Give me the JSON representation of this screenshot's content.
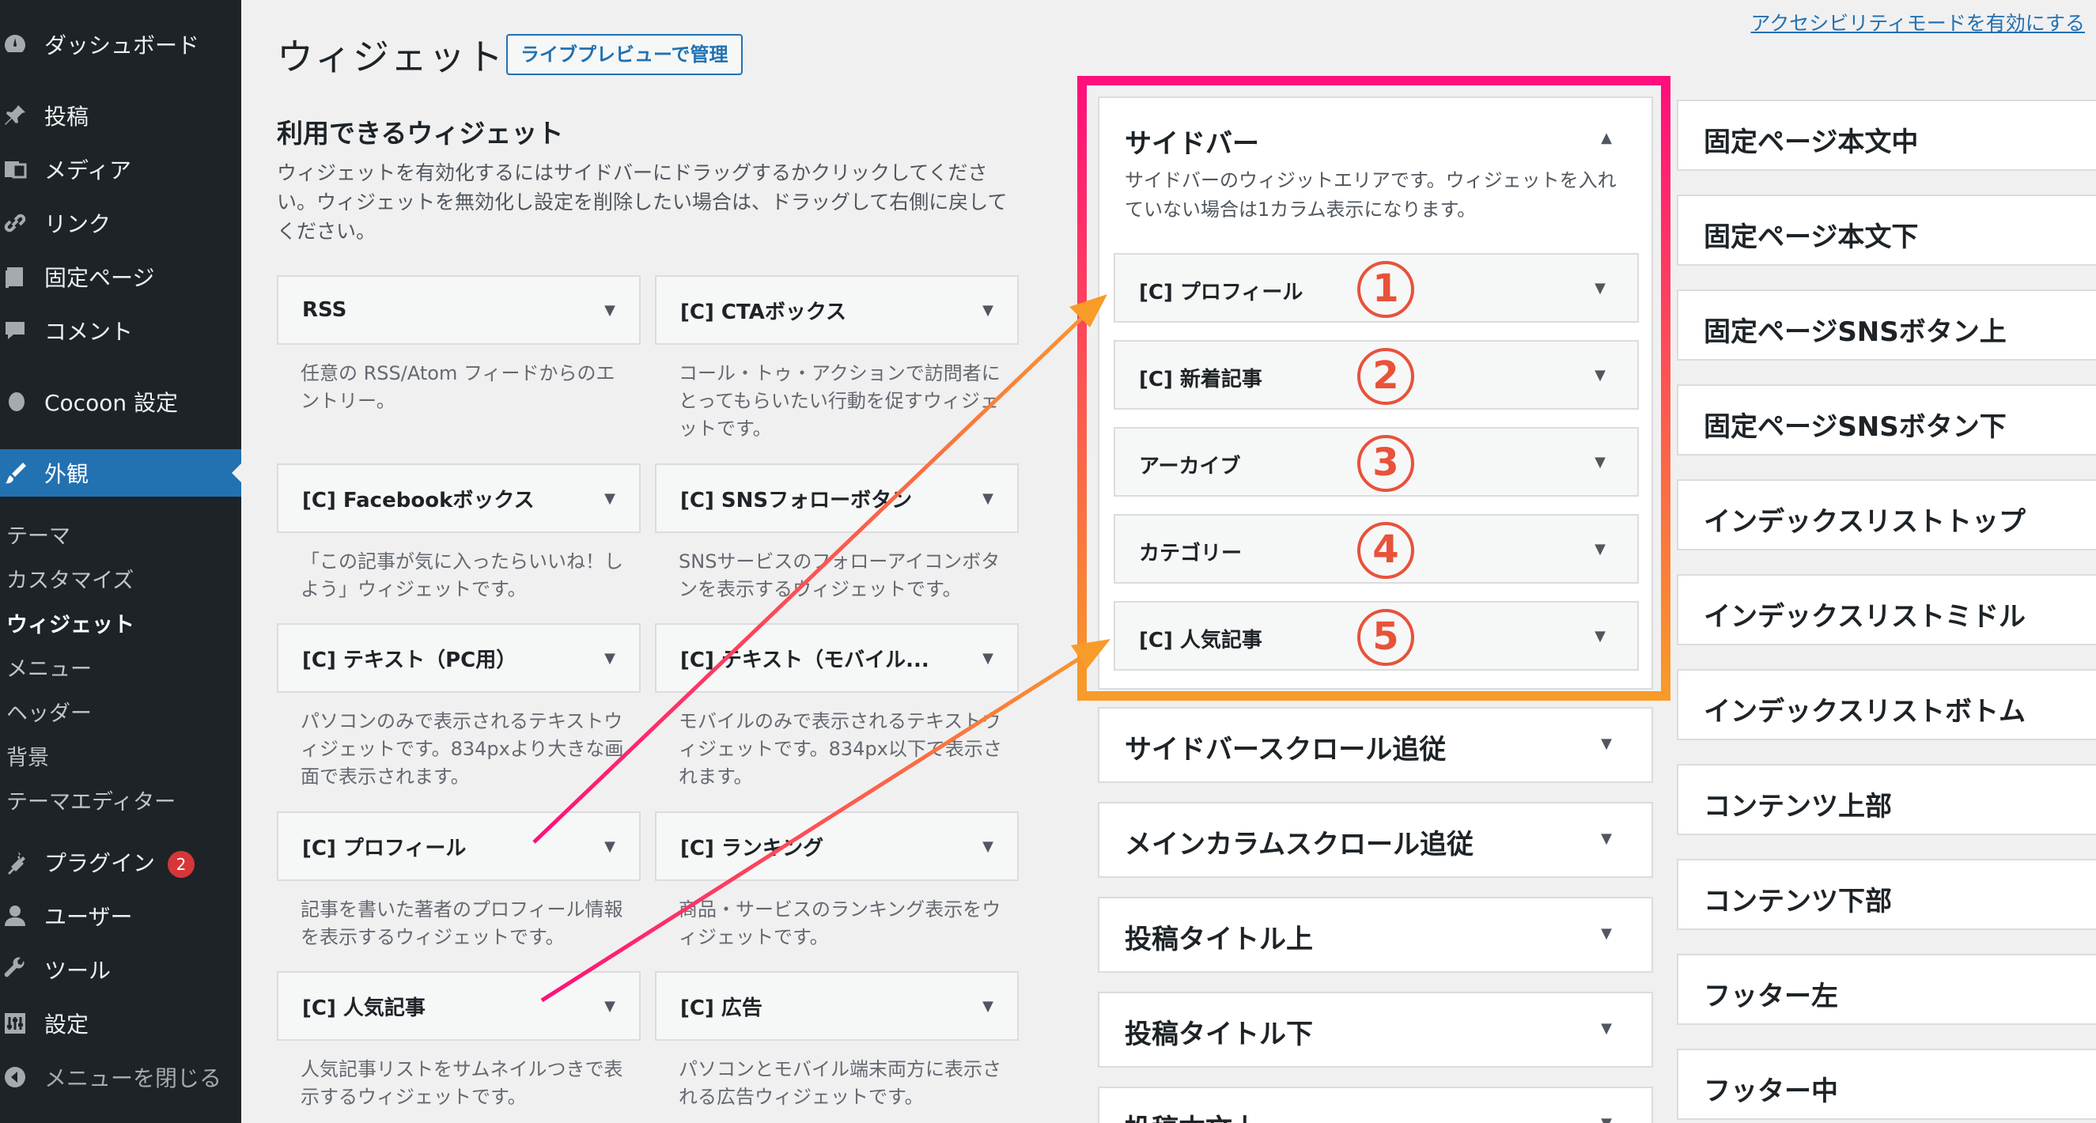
{
  "sidebar": {
    "items": [
      {
        "label": "ダッシュボード",
        "icon": "dashboard-icon"
      },
      {
        "label": "投稿",
        "icon": "pin-icon"
      },
      {
        "label": "メディア",
        "icon": "media-icon"
      },
      {
        "label": "リンク",
        "icon": "link-icon"
      },
      {
        "label": "固定ページ",
        "icon": "page-icon"
      },
      {
        "label": "コメント",
        "icon": "comment-icon"
      },
      {
        "label": "Cocoon 設定",
        "icon": "cocoon-icon"
      },
      {
        "label": "外観",
        "icon": "brush-icon"
      }
    ],
    "submenu": [
      "テーマ",
      "カスタマイズ",
      "ウィジェット",
      "メニュー",
      "ヘッダー",
      "背景",
      "テーマエディター"
    ],
    "items_after": [
      {
        "label": "プラグイン",
        "icon": "plugin-icon",
        "badge": "2"
      },
      {
        "label": "ユーザー",
        "icon": "user-icon"
      },
      {
        "label": "ツール",
        "icon": "wrench-icon"
      },
      {
        "label": "設定",
        "icon": "settings-icon"
      },
      {
        "label": "メニューを閉じる",
        "icon": "collapse-icon"
      }
    ]
  },
  "header": {
    "title": "ウィジェット",
    "live_preview": "ライブプレビューで管理",
    "accessibility_link": "アクセシビリティモードを有効にする"
  },
  "available": {
    "heading": "利用できるウィジェット",
    "description": "ウィジェットを有効化するにはサイドバーにドラッグするかクリックしてください。ウィジェットを無効化し設定を削除したい場合は、ドラッグして右側に戻してください。",
    "widgets": [
      {
        "title": "RSS",
        "desc": "任意の RSS/Atom フィードからのエントリー。"
      },
      {
        "title": "[C] CTAボックス",
        "desc": "コール・トゥ・アクションで訪問者にとってもらいたい行動を促すウィジェットです。"
      },
      {
        "title": "[C] Facebookボックス",
        "desc": "「この記事が気に入ったらいいね！しよう」ウィジェットです。"
      },
      {
        "title": "[C] SNSフォローボタン",
        "desc": "SNSサービスのフォローアイコンボタンを表示するウィジェットです。"
      },
      {
        "title": "[C] テキスト（PC用）",
        "desc": "パソコンのみで表示されるテキストウィジェットです。834pxより大きな画面で表示されます。"
      },
      {
        "title": "[C] テキスト（モバイル...",
        "desc": "モバイルのみで表示されるテキストウィジェットです。834px以下で表示されます。"
      },
      {
        "title": "[C] プロフィール",
        "desc": "記事を書いた著者のプロフィール情報を表示するウィジェットです。"
      },
      {
        "title": "[C] ランキング",
        "desc": "商品・サービスのランキング表示をウィジェットです。"
      },
      {
        "title": "[C] 人気記事",
        "desc": "人気記事リストをサムネイルつきで表示するウィジェットです。"
      },
      {
        "title": "[C] 広告",
        "desc": "パソコンとモバイル端末両方に表示される広告ウィジェットです。"
      }
    ]
  },
  "sidebar_area": {
    "title": "サイドバー",
    "description": "サイドバーのウィジットエリアです。ウィジェットを入れていない場合は1カラム表示になります。",
    "widgets": [
      {
        "title": "[C] プロフィール",
        "num": "1"
      },
      {
        "title": "[C] 新着記事",
        "num": "2"
      },
      {
        "title": "アーカイブ",
        "num": "3"
      },
      {
        "title": "カテゴリー",
        "num": "4"
      },
      {
        "title": "[C] 人気記事",
        "num": "5"
      }
    ]
  },
  "areas_col2": [
    "サイドバースクロール追従",
    "メインカラムスクロール追従",
    "投稿タイトル上",
    "投稿タイトル下",
    "投稿本文上"
  ],
  "areas_col3": [
    "固定ページ本文中",
    "固定ページ本文下",
    "固定ページSNSボタン上",
    "固定ページSNSボタン下",
    "インデックスリストトップ",
    "インデックスリストミドル",
    "インデックスリストボトム",
    "コンテンツ上部",
    "コンテンツ下部",
    "フッター左",
    "フッター中"
  ],
  "colors": {
    "menu_bg": "#1d2327",
    "accent": "#2271b1",
    "highlight_top": "#ff0f7b",
    "highlight_bottom": "#f89b29",
    "badge": "#d63638"
  }
}
